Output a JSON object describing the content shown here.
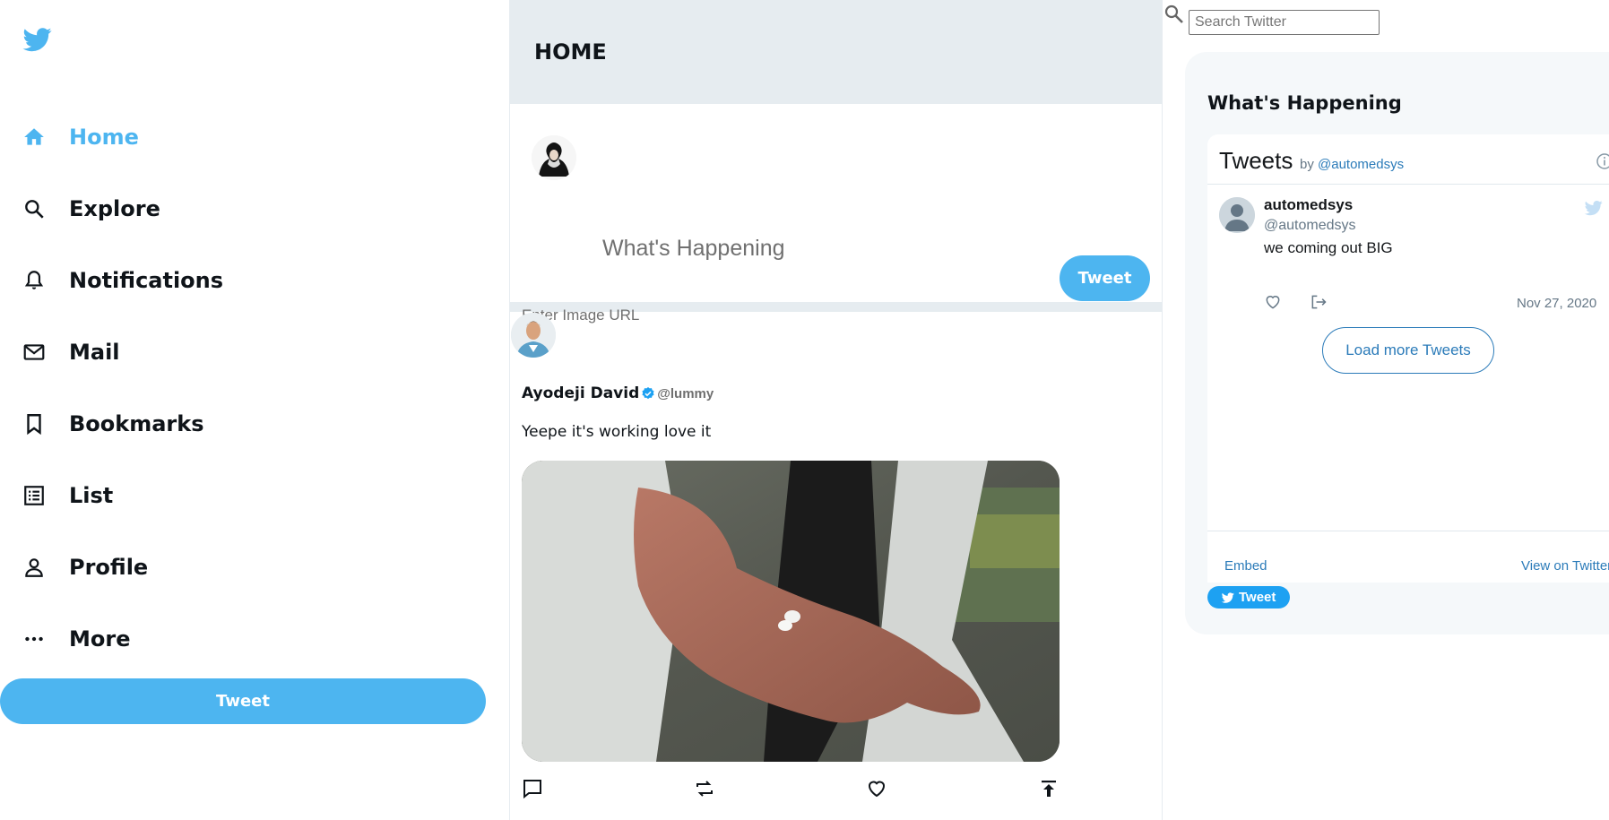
{
  "sidebar": {
    "logo": "twitter-bird-icon",
    "items": [
      {
        "label": "Home",
        "icon": "home-icon",
        "active": true
      },
      {
        "label": "Explore",
        "icon": "search-icon"
      },
      {
        "label": "Notifications",
        "icon": "bell-icon"
      },
      {
        "label": "Mail",
        "icon": "mail-icon"
      },
      {
        "label": "Bookmarks",
        "icon": "bookmark-icon"
      },
      {
        "label": "List",
        "icon": "list-icon"
      },
      {
        "label": "Profile",
        "icon": "profile-icon"
      },
      {
        "label": "More",
        "icon": "more-icon"
      }
    ],
    "tweet_button": "Tweet",
    "accent": "#4db5f0"
  },
  "feed": {
    "title": "HOME",
    "composer": {
      "placeholder": "What's Happening",
      "image_url_placeholder": "Enter Image URL",
      "tweet_button": "Tweet"
    },
    "post": {
      "name": "Ayodeji David",
      "handle": "@lummy",
      "verified": true,
      "text": "Yeepe it's working love it",
      "actions": [
        "reply-icon",
        "retweet-icon",
        "like-icon",
        "share-icon"
      ]
    }
  },
  "right": {
    "search_placeholder": "Search Twitter",
    "widget_title": "What's Happening",
    "embed": {
      "title": "Tweets",
      "by_prefix": "by",
      "by_handle": "@automedsys",
      "tweet": {
        "name": "automedsys",
        "handle": "@automedsys",
        "text": "we coming out BIG",
        "date": "Nov 27, 2020"
      },
      "load_more": "Load more Tweets",
      "embed_link": "Embed",
      "view_link": "View on Twitter"
    },
    "share_tweet_button": "Tweet"
  }
}
